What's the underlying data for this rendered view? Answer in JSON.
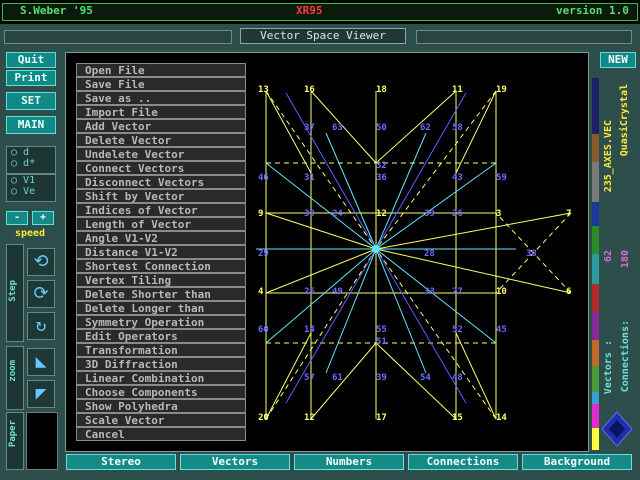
{
  "title": {
    "left": "S.Weber '95",
    "center": "XR95",
    "right": "version 1.0"
  },
  "window_title": "Vector Space Viewer",
  "left_buttons": [
    "Quit",
    "Print",
    "SET",
    "MAIN"
  ],
  "radio_groups": {
    "group1": [
      "d",
      "d*"
    ],
    "group2": [
      "V1",
      "Ve"
    ]
  },
  "speed": {
    "minus": "-",
    "plus": "+",
    "label": "speed"
  },
  "side_labels": {
    "step": "Step",
    "zoom": "zoom",
    "paper": "Paper"
  },
  "menu": [
    "Open File",
    "Save File",
    "Save as ..",
    "Import File",
    "Add Vector",
    "Delete Vector",
    "Undelete Vector",
    "Connect Vectors",
    "Disconnect Vectors",
    "Shift by Vector",
    "Indices of Vector",
    "Length of Vector",
    "Angle V1-V2",
    "Distance V1-V2",
    "Shortest Connection",
    "Vertex Tiling",
    "Delete Shorter than",
    "Delete Longer than",
    "Symmetry Operation",
    "Edit Operators",
    "Transformation",
    "3D Diffraction",
    "Linear Combination",
    "Choose Components",
    "Show Polyhedra",
    "Scale Vector",
    "Cancel"
  ],
  "node_labels": [
    "13",
    "16",
    "18",
    "11",
    "19",
    "37",
    "63",
    "50",
    "62",
    "58",
    "32",
    "46",
    "31",
    "36",
    "43",
    "59",
    "7",
    "9",
    "30",
    "24",
    "12",
    "39",
    "26",
    "3",
    "29",
    "28",
    "38",
    "4",
    "25",
    "49",
    "33",
    "27",
    "10",
    "6",
    "60",
    "14",
    "55",
    "52",
    "45",
    "51",
    "57",
    "61",
    "39",
    "54",
    "48",
    "20",
    "12",
    "17",
    "15",
    "14"
  ],
  "right_panel": {
    "new_button": "NEW",
    "file": "235_AXES.VEC",
    "name": "QuasiCrystal",
    "vectors_label": "Vectors :",
    "vectors_value": "62",
    "connections_label": "Connections:",
    "connections_value": "180"
  },
  "bottom_buttons": [
    "Stereo",
    "Vectors",
    "Numbers",
    "Connections",
    "Background"
  ],
  "colors": {
    "accent": "#118a86",
    "title_green": "#2fbf3c",
    "node_yellow": "#ffff6a",
    "node_blue": "#5a5cff",
    "line_cyan": "#63e6ff"
  }
}
